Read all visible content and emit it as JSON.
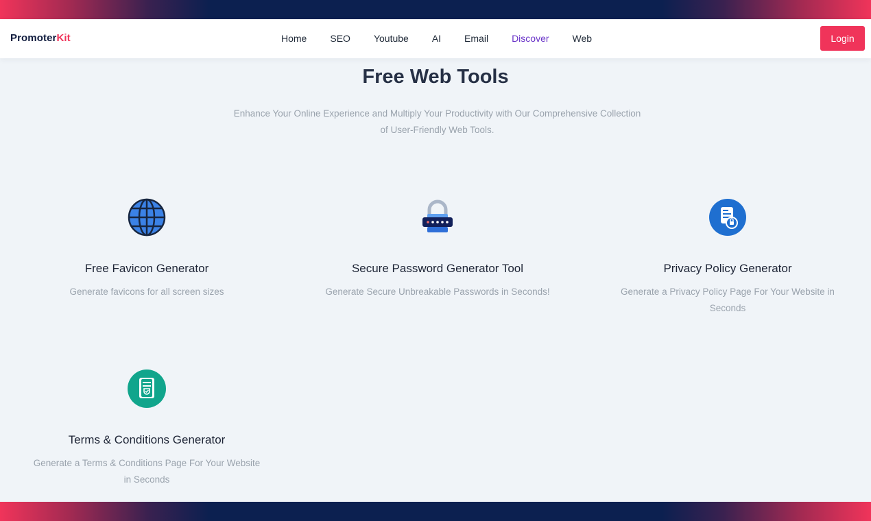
{
  "brand": {
    "name_main": "Promoter",
    "name_accent": "Kit",
    "accent_color": "#f0345a"
  },
  "nav": {
    "links": [
      "Home",
      "SEO",
      "Youtube",
      "AI",
      "Email",
      "Discover",
      "Web"
    ],
    "active": "Discover",
    "login_label": "Login"
  },
  "hero": {
    "title": "Free Web Tools",
    "subtitle": "Enhance Your Online Experience and Multiply Your Productivity with Our Comprehensive Collection of User-Friendly Web Tools."
  },
  "tools": [
    {
      "title": "Free Favicon Generator",
      "description": "Generate favicons for all screen sizes",
      "icon": "globe-icon"
    },
    {
      "title": "Secure Password Generator Tool",
      "description": "Generate Secure Unbreakable Passwords in Seconds!",
      "icon": "password-lock-icon"
    },
    {
      "title": "Privacy Policy Generator",
      "description": "Generate a Privacy Policy Page For Your Website in Seconds",
      "icon": "privacy-document-icon"
    },
    {
      "title": "Terms & Conditions Generator",
      "description": "Generate a Terms & Conditions Page For Your Website in Seconds",
      "icon": "terms-document-icon"
    }
  ],
  "colors": {
    "nav_active": "#6a34c8",
    "login_button": "#f0345a",
    "band_dark": "#0c2050"
  }
}
